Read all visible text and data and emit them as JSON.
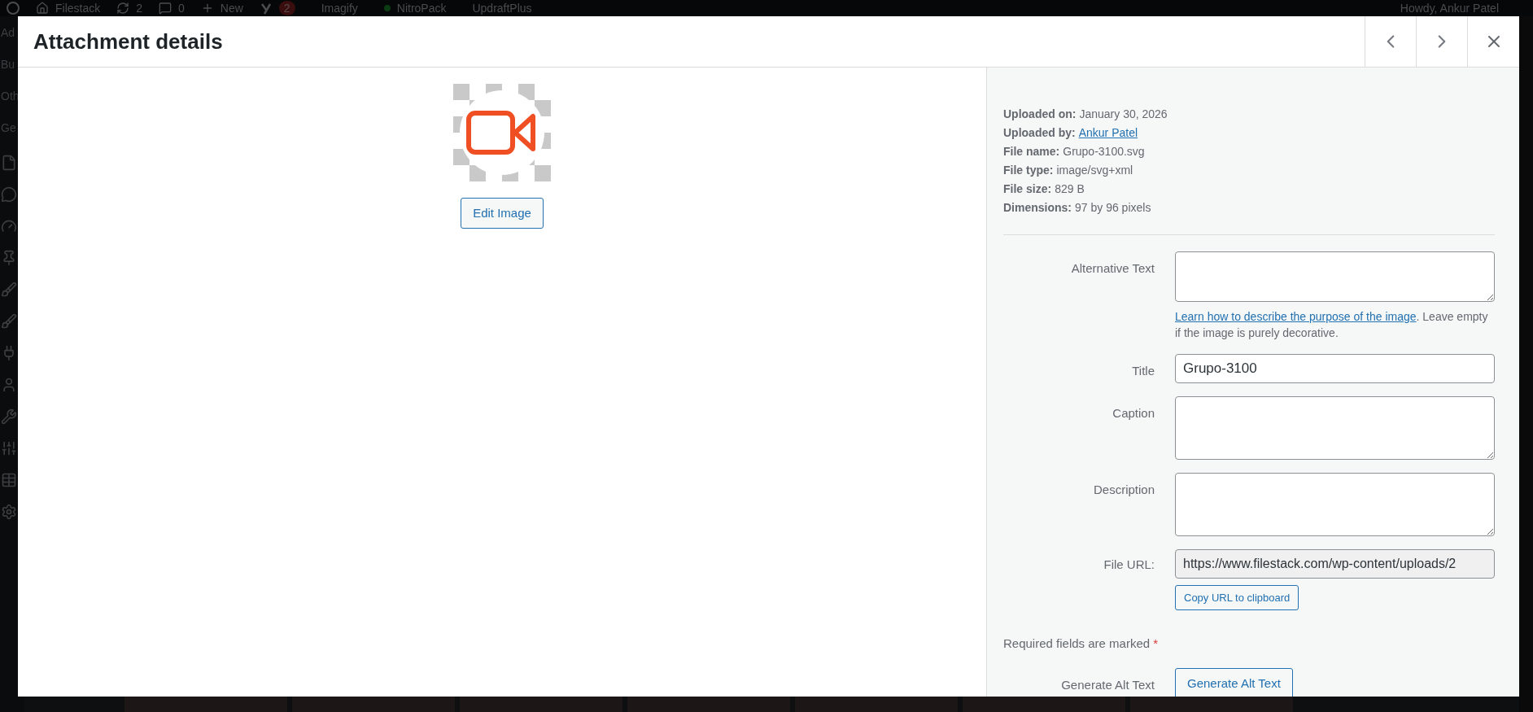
{
  "admin_bar": {
    "site": "Filestack",
    "updates": "2",
    "comments": "0",
    "new": "New",
    "seo_badge": "2",
    "plugins": [
      "Imagify",
      "NitroPack",
      "UpdraftPlus"
    ],
    "greeting": "Howdy, Ankur Patel"
  },
  "sidebar": {
    "menu_fragments": [
      "Ad",
      "Bu",
      "Oth",
      "Ge"
    ]
  },
  "modal": {
    "title": "Attachment details",
    "preview": {
      "edit_button": "Edit Image"
    },
    "details": [
      {
        "label": "Uploaded on:",
        "value": "January 30, 2026",
        "kind": "text"
      },
      {
        "label": "Uploaded by:",
        "value": "Ankur Patel",
        "kind": "link"
      },
      {
        "label": "File name:",
        "value": "Grupo-3100.svg",
        "kind": "text"
      },
      {
        "label": "File type:",
        "value": "image/svg+xml",
        "kind": "text"
      },
      {
        "label": "File size:",
        "value": "829 B",
        "kind": "text"
      },
      {
        "label": "Dimensions:",
        "value": "97 by 96 pixels",
        "kind": "text"
      }
    ],
    "fields": [
      {
        "label": "Alternative Text",
        "kind": "textarea",
        "help_link": "Learn how to describe the purpose of the image",
        "help_text": ". Leave empty if the image is purely decorative."
      },
      {
        "label": "Title",
        "kind": "input",
        "value": "Grupo-3100"
      },
      {
        "label": "Caption",
        "kind": "textarea"
      },
      {
        "label": "Description",
        "kind": "textarea"
      },
      {
        "label": "File URL:",
        "kind": "readonly",
        "value": "https://www.filestack.com/wp-content/uploads/2",
        "button": "Copy URL to clipboard"
      }
    ],
    "required_note": "Required fields are marked",
    "required_mark": "*",
    "generate": {
      "label": "Generate Alt Text",
      "button": "Generate Alt Text"
    }
  }
}
